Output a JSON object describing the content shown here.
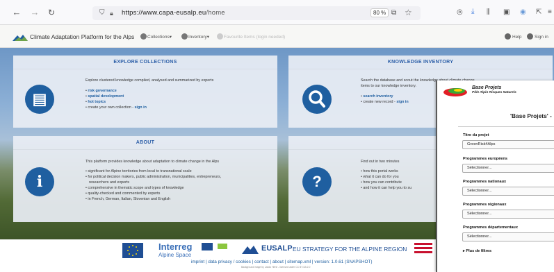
{
  "browser": {
    "url_host": "https://www.capa-eusalp.eu",
    "url_path": "/home",
    "zoom": "80 %"
  },
  "app": {
    "title": "Climate Adaptation Platform for the Alps",
    "nav": [
      "Collections▾",
      "Inventory▾",
      "Favourite Items (login needed)"
    ],
    "help": "Help",
    "signin": "Sign in"
  },
  "panels": {
    "explore": {
      "title": "EXPLORE COLLECTIONS",
      "intro": "Explore clustered knowledge compiled, analysed and summarized by experts",
      "links": [
        "risk governance",
        "spatial development",
        "hot topics"
      ],
      "create_text": "create your own collection -",
      "create_link": "sign in"
    },
    "knowledge": {
      "title": "KNOWLEDGE INVENTORY",
      "intro1": "Search the database and scout the knowledge about climate change",
      "intro2": "items to our knowledge inventory.",
      "link1": "search inventory",
      "create_text": "create new record -",
      "create_link": "sign in"
    },
    "about": {
      "title": "ABOUT",
      "intro": "This platform provides knowledge about adaptation to climate change in the Alps",
      "bullets": [
        "significant for Alpine territories from local to transnational scale",
        "for political decision makers, public administration, municipalities, entrepreneurs,",
        "researchers and experts",
        "comprehensive in thematic scope and types of knowledge",
        "quality-checked and commented by experts",
        "in French, German, Italian, Slovenian and English"
      ]
    },
    "howto": {
      "title": "HOW-TO?",
      "intro": "Find out in two minutes",
      "bullets": [
        "how this portal works",
        "what it can do for you",
        "how you can contribute",
        "and how it can help you to su"
      ]
    }
  },
  "footer": {
    "interreg": "Interreg",
    "alpine_space": "Alpine Space",
    "eusalp": "EUSALP",
    "strategy": "EU STRATEGY FOR THE ALPINE REGION",
    "links": "imprint | data privacy / cookies | contact | about | sitemap.xml | version: 1.0.61 (SNAPSHOT)",
    "credit": "Background image by Lando Hénir - licensed under CC BY-SA 2.0"
  },
  "modal": {
    "brand1": "Base Projets",
    "brand2": "Pôle Alpin Risques Naturels",
    "heading": "'Base Projets' -",
    "title_label": "Titre du projet",
    "title_value": "GreenRisk4Alps",
    "fields": [
      {
        "label": "Programmes européens",
        "value": "Sélectionner..."
      },
      {
        "label": "Programmes nationaux",
        "value": "Sélectionner..."
      },
      {
        "label": "Programmes régionaux",
        "value": "Sélectionner..."
      },
      {
        "label": "Programmes départementaux",
        "value": "Sélectionner..."
      }
    ],
    "more_filters": "Plus de filtres"
  },
  "colors": {
    "primary": "#1f5fa0",
    "panel_title": "#2d5fa8",
    "eusalp_blue": "#1f4e94"
  }
}
